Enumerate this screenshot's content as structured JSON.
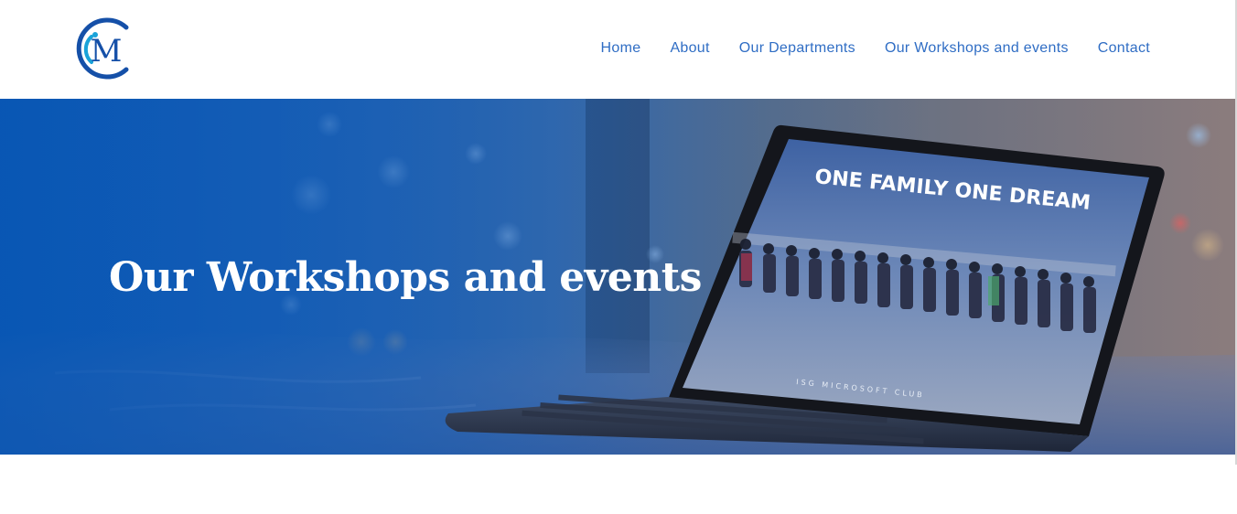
{
  "brand": {
    "logo_letter": "M",
    "logo_colors": {
      "primary": "#1550a8",
      "accent": "#1aa3d9"
    }
  },
  "nav": {
    "items": [
      {
        "label": "Home"
      },
      {
        "label": "About"
      },
      {
        "label": "Our Departments"
      },
      {
        "label": "Our Workshops and events"
      },
      {
        "label": "Contact"
      }
    ]
  },
  "hero": {
    "title": "Our Workshops and events",
    "screen_banner": "ONE FAMILY ONE DREAM",
    "screen_footer": "ISG MICROSOFT CLUB"
  },
  "colors": {
    "nav_link": "#2f6dc4",
    "hero_blue": "#0d5ab6"
  }
}
